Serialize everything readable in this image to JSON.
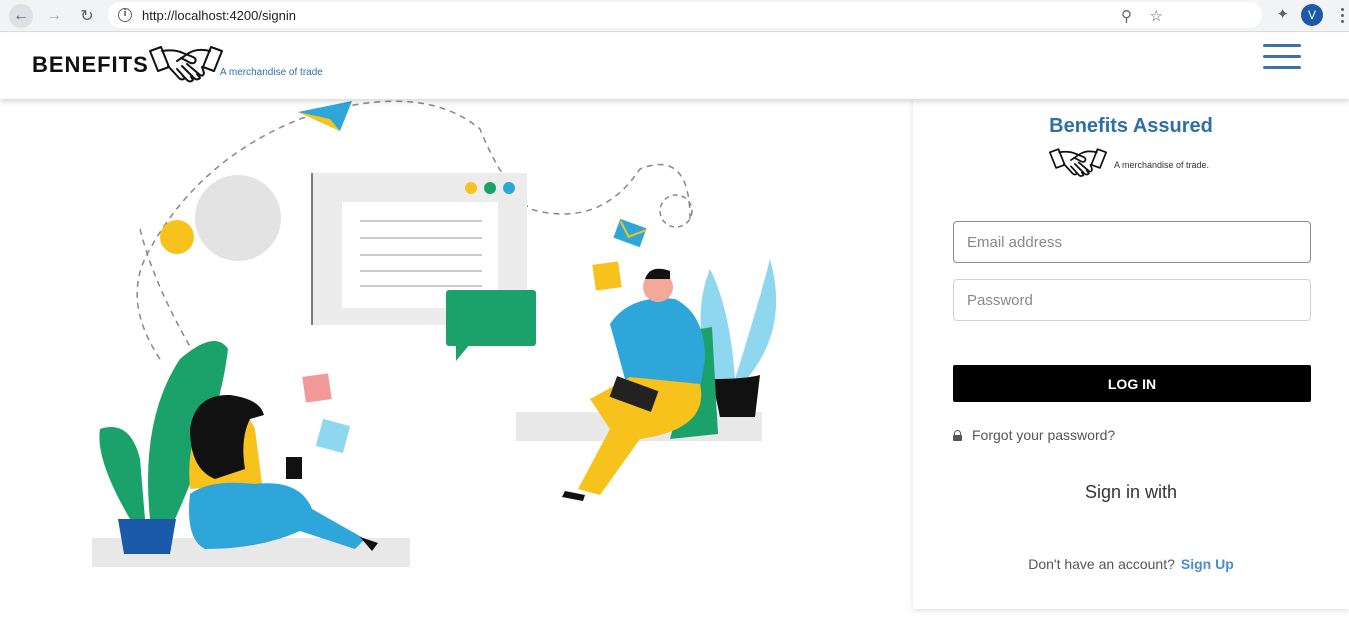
{
  "browser": {
    "url": "http://localhost:4200/signin",
    "profile_initial": "V"
  },
  "header": {
    "brand": "BENEFITS",
    "tagline": "A merchandise of trade"
  },
  "panel": {
    "title": "Benefits Assured",
    "tagline": "A merchandise of trade.",
    "email_placeholder": "Email address",
    "password_placeholder": "Password",
    "login_label": "LOG IN",
    "forgot_label": "Forgot your password?",
    "signin_with": "Sign in with",
    "no_account": "Don't have an account?",
    "signup_label": "Sign Up"
  },
  "colors": {
    "brand_blue": "#2f6fa8",
    "link_blue": "#4a8cd0",
    "button": "#000000"
  }
}
